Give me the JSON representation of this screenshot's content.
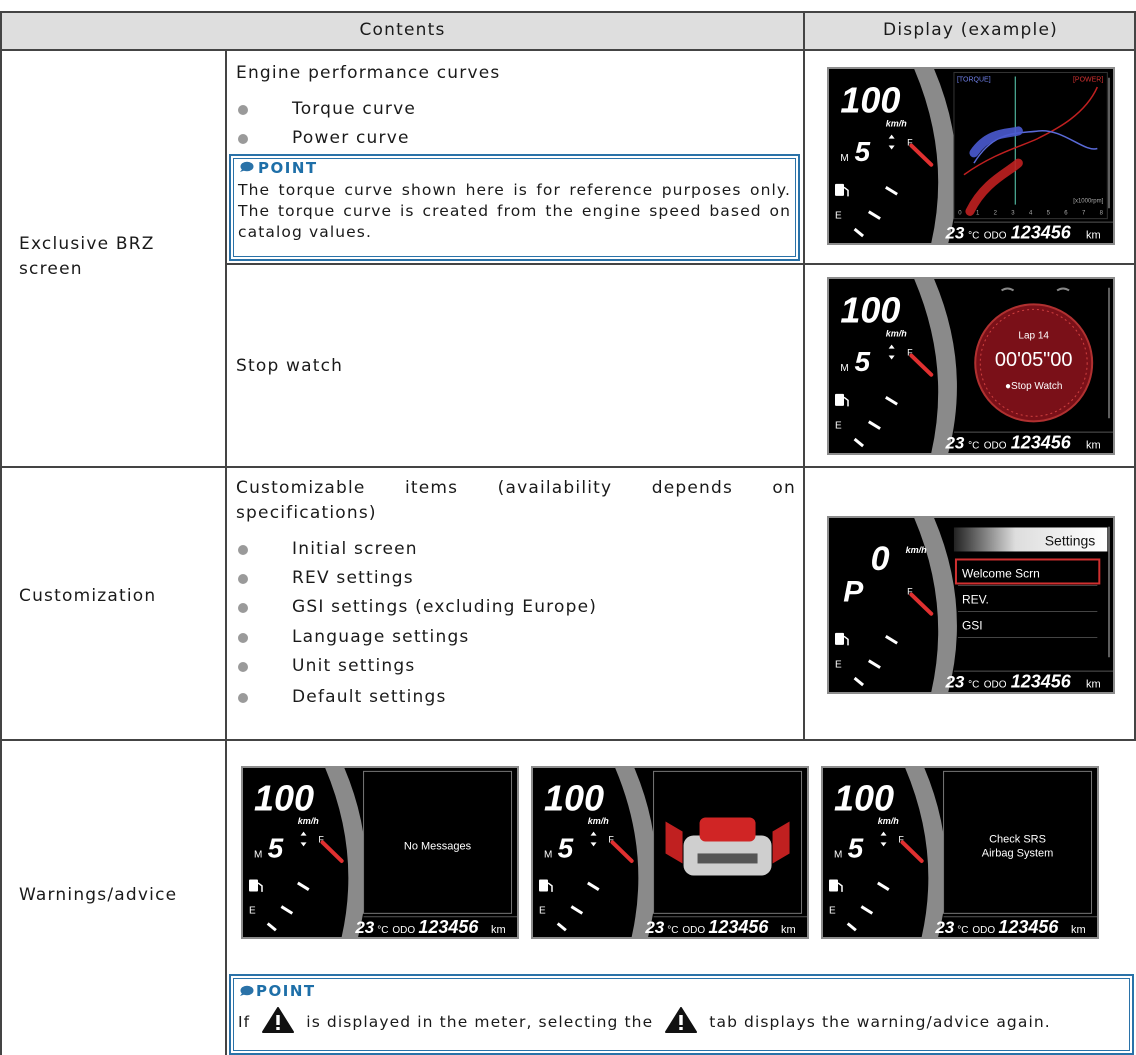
{
  "header": {
    "contents": "Contents",
    "display": "Display (example)"
  },
  "row_brz": {
    "label": "Exclusive BRZ screen",
    "perf_title": "Engine performance curves",
    "items": [
      "Torque curve",
      "Power curve"
    ],
    "point_title": "POINT",
    "point_text": "The torque curve shown here is for reference purposes only. The torque curve is created from the engine speed based on catalog values.",
    "stopwatch": "Stop watch"
  },
  "row_custom": {
    "label": "Customization",
    "intro": "Customizable items (availability depends on specifications)",
    "items": [
      "Initial screen",
      "REV settings",
      "GSI settings (excluding Europe)",
      "Language settings",
      "Unit settings",
      "Default settings"
    ]
  },
  "row_warn": {
    "label": "Warnings/advice",
    "point_title": "POINT",
    "point_text_1": "If",
    "point_text_2": "is displayed in the meter, selecting the",
    "point_text_3": "tab displays the warning/advice again."
  },
  "meter": {
    "speed": "100",
    "speed_zero": "0",
    "unit": "km/h",
    "gear": "5",
    "gear_p": "P",
    "mode": "M",
    "fuel_e": "E",
    "fuel_f": "F",
    "temp": "23",
    "temp_unit": "°C",
    "odo_label": "ODO",
    "odo": "123456",
    "odo_unit": "km",
    "torque_label": "[TORQUE]",
    "power_label": "[POWER]",
    "rpm_label": "[x1000rpm]",
    "rpm_ticks": [
      "0",
      "1",
      "2",
      "3",
      "4",
      "5",
      "6",
      "7",
      "8"
    ],
    "lap": "Lap 14",
    "time": "00'05\"00",
    "stopwatch_label": "●Stop Watch",
    "settings_title": "Settings",
    "settings_items": [
      "Welcome Scrn",
      "REV.",
      "GSI"
    ],
    "no_messages": "No Messages",
    "srs_line1": "Check SRS",
    "srs_line2": "Airbag System"
  },
  "colors": {
    "accent": "#2a72a8",
    "header_bg": "#dedede",
    "needle": "#d03030"
  }
}
